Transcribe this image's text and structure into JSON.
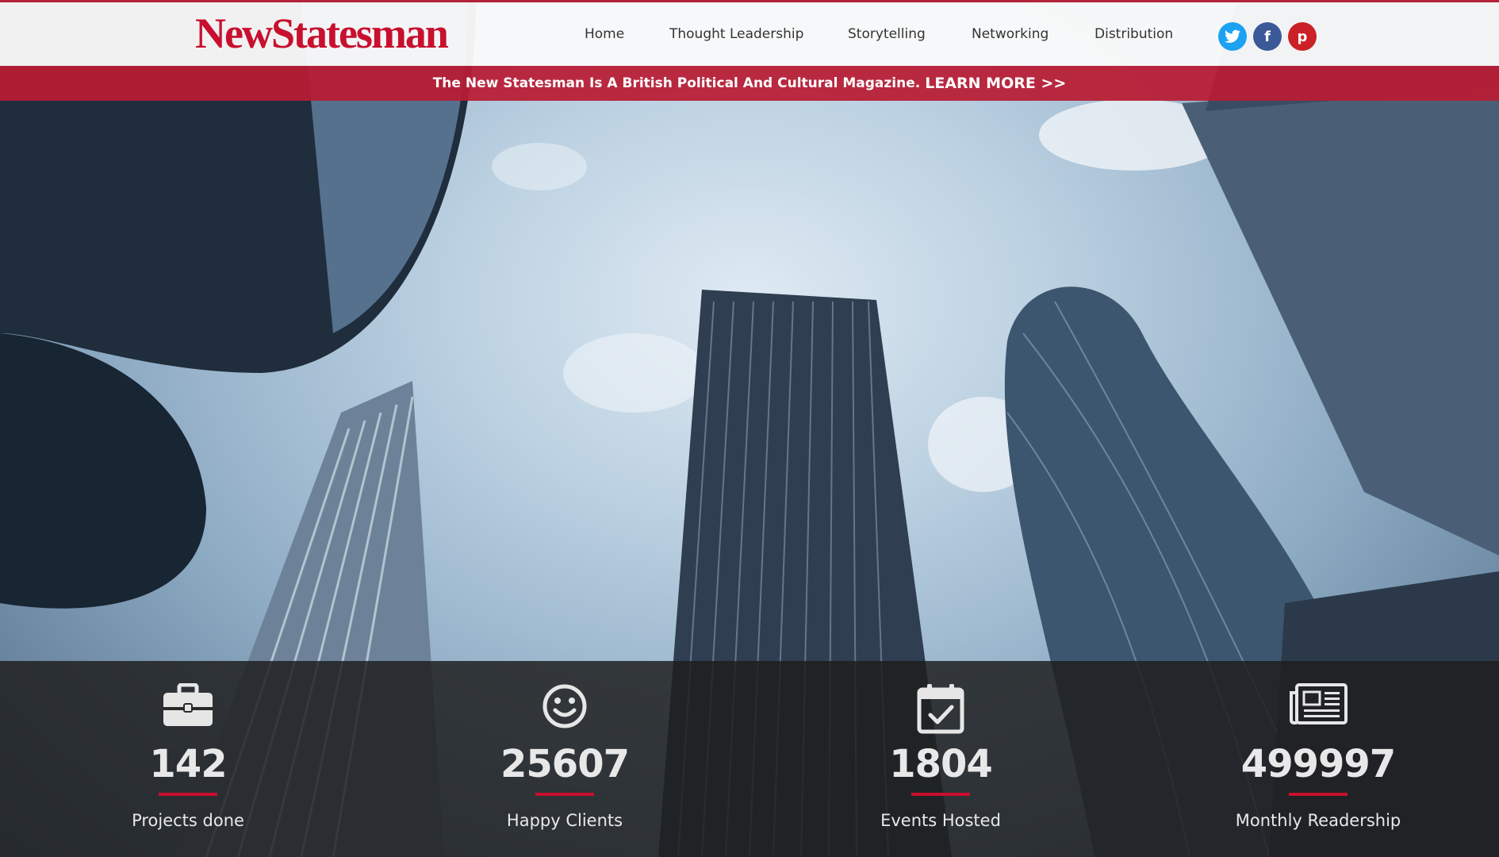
{
  "brand": {
    "logo_text": "NewStatesman",
    "color": "#c8102e"
  },
  "nav": {
    "items": [
      "Home",
      "Thought Leadership",
      "Storytelling",
      "Networking",
      "Distribution"
    ]
  },
  "social": [
    {
      "icon": "twitter-icon",
      "glyph": "t",
      "color": "#1da1f2"
    },
    {
      "icon": "facebook-icon",
      "glyph": "f",
      "color": "#3b5998"
    },
    {
      "icon": "pinterest-icon",
      "glyph": "p",
      "color": "#cb2027"
    }
  ],
  "banner": {
    "text": "The New Statesman Is A British Political And Cultural Magazine.",
    "link": "LEARN MORE >>",
    "color": "#b81c34"
  },
  "stats": [
    {
      "icon": "briefcase-icon",
      "value": "142",
      "label": "Projects done"
    },
    {
      "icon": "smiley-icon",
      "value": "25607",
      "label": "Happy Clients"
    },
    {
      "icon": "calendar-check-icon",
      "value": "1804",
      "label": "Events Hosted"
    },
    {
      "icon": "newspaper-icon",
      "value": "499997",
      "label": "Monthly Readership"
    }
  ]
}
